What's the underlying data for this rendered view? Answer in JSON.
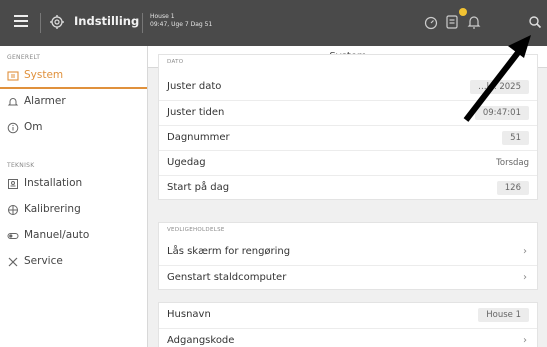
{
  "topbar": {
    "title": "Indstilling",
    "house_name": "House 1",
    "house_info": "09:47, Uge 7 Dag 51",
    "icons": [
      "menu-icon",
      "gear-icon",
      "timer-icon",
      "report-icon",
      "bell-icon",
      "search-icon"
    ],
    "notification_color": "#f1c232"
  },
  "sidebar": {
    "section_general": "GENERELT",
    "section_technical": "TEKNISK",
    "items": [
      {
        "label": "System",
        "icon": "system-icon",
        "active": true
      },
      {
        "label": "Alarmer",
        "icon": "bell-icon"
      },
      {
        "label": "Om",
        "icon": "info-icon"
      },
      {
        "label": "Installation",
        "icon": "installation-icon"
      },
      {
        "label": "Kalibrering",
        "icon": "calibration-icon"
      },
      {
        "label": "Manuel/auto",
        "icon": "manual-auto-icon"
      },
      {
        "label": "Service",
        "icon": "service-icon"
      }
    ],
    "accent_color": "#e0913c"
  },
  "content": {
    "title": "System",
    "date_section": {
      "heading": "DATO",
      "rows": [
        {
          "label": "Juster dato",
          "value": "…kl. 2025"
        },
        {
          "label": "Juster tiden",
          "value": "09:47:01"
        },
        {
          "label": "Dagnummer",
          "value": "51"
        },
        {
          "label": "Ugedag",
          "value": "Torsdag"
        },
        {
          "label": "Start på dag",
          "value": "126"
        }
      ]
    },
    "maintenance_section": {
      "heading": "VEDLIGEHOLDELSE",
      "rows": [
        {
          "label": "Lås skærm for rengøring",
          "chevron": "›"
        },
        {
          "label": "Genstart staldcomputer",
          "chevron": "›"
        }
      ]
    },
    "other_section": {
      "rows": [
        {
          "label": "Husnavn",
          "value": "House 1"
        },
        {
          "label": "Adgangskode",
          "chevron": "›"
        }
      ]
    }
  }
}
